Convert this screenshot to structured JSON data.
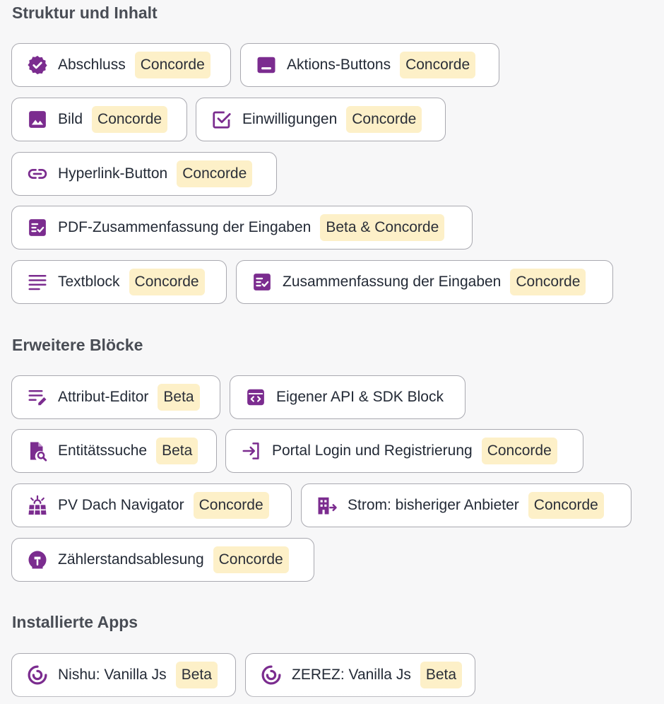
{
  "colors": {
    "accent": "#7b2c8f",
    "badge_bg": "#fdf0c8"
  },
  "sections": {
    "structure": {
      "title": "Struktur und Inhalt",
      "items": [
        {
          "label": "Abschluss",
          "badge": "Concorde",
          "icon": "verified-badge-icon"
        },
        {
          "label": "Aktions-Buttons",
          "badge": "Concorde",
          "icon": "button-bar-icon"
        },
        {
          "label": "Bild",
          "badge": "Concorde",
          "icon": "image-icon"
        },
        {
          "label": "Einwilligungen",
          "badge": "Concorde",
          "icon": "checkbox-icon"
        },
        {
          "label": "Hyperlink-Button",
          "badge": "Concorde",
          "icon": "link-icon"
        },
        {
          "label": "PDF-Zusammenfassung der Eingaben",
          "badge": "Beta & Concorde",
          "icon": "checklist-icon"
        },
        {
          "label": "Textblock",
          "badge": "Concorde",
          "icon": "text-lines-icon"
        },
        {
          "label": "Zusammenfassung der Eingaben",
          "badge": "Concorde",
          "icon": "checklist-icon"
        }
      ]
    },
    "advanced": {
      "title": "Erweitere Blöcke",
      "items": [
        {
          "label": "Attribut-Editor",
          "badge": "Beta",
          "icon": "edit-lines-icon"
        },
        {
          "label": "Eigener API & SDK Block",
          "icon": "code-window-icon"
        },
        {
          "label": "Entitätssuche",
          "badge": "Beta",
          "icon": "document-search-icon"
        },
        {
          "label": "Portal Login und Registrierung",
          "badge": "Concorde",
          "icon": "login-icon"
        },
        {
          "label": "PV Dach Navigator",
          "badge": "Concorde",
          "icon": "solar-panel-icon"
        },
        {
          "label": "Strom: bisheriger Anbieter",
          "badge": "Concorde",
          "icon": "building-arrow-icon"
        },
        {
          "label": "Zählerstandsablesung",
          "badge": "Concorde",
          "icon": "meter-icon"
        }
      ]
    },
    "apps": {
      "title": "Installierte Apps",
      "items": [
        {
          "label": "Nishu: Vanilla Js",
          "badge": "Beta",
          "icon": "app-logo-icon"
        },
        {
          "label": "ZEREZ: Vanilla Js",
          "badge": "Beta",
          "icon": "app-logo-icon"
        }
      ]
    }
  }
}
